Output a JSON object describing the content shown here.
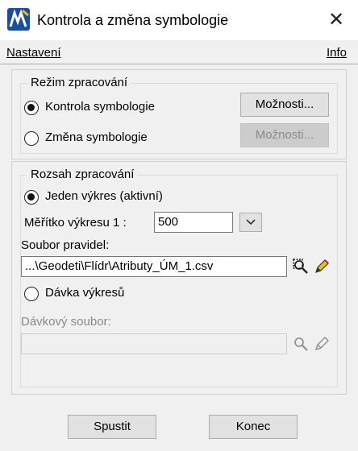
{
  "window": {
    "title": "Kontrola a změna symbologie",
    "close_glyph": "✕"
  },
  "menu": {
    "settings": "Nastavení",
    "info": "Info"
  },
  "processing_mode": {
    "title": "Režim zpracování",
    "option_check": "Kontrola symbologie",
    "option_change": "Změna symbologie",
    "options_button": "Možnosti...",
    "options_button_disabled": "Možnosti..."
  },
  "processing_scope": {
    "title": "Rozsah zpracování",
    "option_single": "Jeden výkres (aktivní)",
    "scale_label": "Měřítko výkresu 1 :",
    "scale_value": "500",
    "rules_label": "Soubor pravidel:",
    "rules_path": "...\\Geodeti\\Flídr\\Atributy_ÚM_1.csv",
    "option_batch": "Dávka výkresů",
    "batch_file_label": "Dávkový soubor:",
    "batch_file_value": ""
  },
  "footer": {
    "run": "Spustit",
    "end": "Konec"
  },
  "icons": {
    "app": "microstation-icon",
    "browse": "search-icon",
    "edit": "pencil-icon",
    "dropdown": "chevron-down-icon"
  },
  "colors": {
    "accent": "#1a4fa0",
    "disabled_text": "#8a8a8a",
    "pencil": "#e8c21a"
  }
}
